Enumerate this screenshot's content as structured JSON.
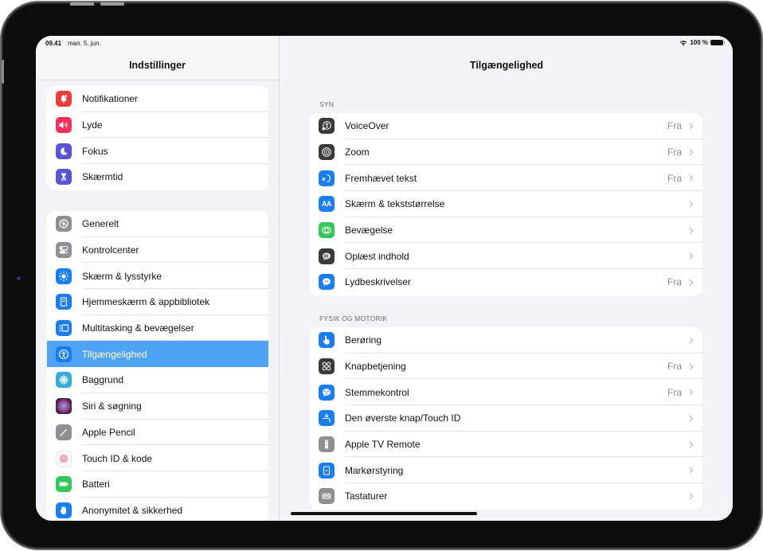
{
  "statusbar": {
    "time": "09.41",
    "date": "man. 5. jun.",
    "battery": "100 %"
  },
  "sidebar": {
    "title": "Indstillinger",
    "group1": [
      {
        "label": "Notifikationer",
        "icon": "bell-icon",
        "color": "#f23a3a"
      },
      {
        "label": "Lyde",
        "icon": "speaker-icon",
        "color": "#f5305a"
      },
      {
        "label": "Fokus",
        "icon": "moon-icon",
        "color": "#5b53d6"
      },
      {
        "label": "Skærmtid",
        "icon": "hourglass-icon",
        "color": "#5b53d6"
      }
    ],
    "group2": [
      {
        "label": "Generelt",
        "icon": "gear-icon",
        "color": "#8e8e93"
      },
      {
        "label": "Kontrolcenter",
        "icon": "toggles-icon",
        "color": "#8e8e93"
      },
      {
        "label": "Skærm & lysstyrke",
        "icon": "sun-icon",
        "color": "#1a7df2"
      },
      {
        "label": "Hjemmeskærm & appbibliotek",
        "icon": "home-screen-icon",
        "color": "#1a7df2"
      },
      {
        "label": "Multitasking & bevægelser",
        "icon": "multitasking-icon",
        "color": "#1a7df2"
      },
      {
        "label": "Tilgængelighed",
        "icon": "accessibility-icon",
        "color": "#1a7df2",
        "selected": true
      },
      {
        "label": "Baggrund",
        "icon": "flower-icon",
        "color": "#36aadc"
      },
      {
        "label": "Siri & søgning",
        "icon": "siri-icon",
        "color": "#2a2a3a"
      },
      {
        "label": "Apple Pencil",
        "icon": "pencil-icon",
        "color": "#8e8e93"
      },
      {
        "label": "Touch ID & kode",
        "icon": "fingerprint-icon",
        "color": "#ffffff"
      },
      {
        "label": "Batteri",
        "icon": "battery-icon",
        "color": "#34c759"
      },
      {
        "label": "Anonymitet & sikkerhed",
        "icon": "hand-icon",
        "color": "#1a7df2"
      }
    ]
  },
  "main": {
    "title": "Tilgængelighed",
    "sections": [
      {
        "header": "SYN",
        "items": [
          {
            "label": "VoiceOver",
            "value": "Fra",
            "icon": "voiceover-icon",
            "color": "#3a3a3c"
          },
          {
            "label": "Zoom",
            "value": "Fra",
            "icon": "zoom-icon",
            "color": "#3a3a3c"
          },
          {
            "label": "Fremhævet tekst",
            "value": "Fra",
            "icon": "hover-text-icon",
            "color": "#1a7df2"
          },
          {
            "label": "Skærm & tekststørrelse",
            "value": "",
            "icon": "text-size-icon",
            "color": "#1a7df2"
          },
          {
            "label": "Bevægelse",
            "value": "",
            "icon": "motion-icon",
            "color": "#34c759"
          },
          {
            "label": "Oplæst indhold",
            "value": "",
            "icon": "spoken-content-icon",
            "color": "#3a3a3c"
          },
          {
            "label": "Lydbeskrivelser",
            "value": "Fra",
            "icon": "audio-descriptions-icon",
            "color": "#1a7df2"
          }
        ]
      },
      {
        "header": "FYSIK OG MOTORIK",
        "items": [
          {
            "label": "Berøring",
            "value": "",
            "icon": "touch-icon",
            "color": "#1a7df2"
          },
          {
            "label": "Knapbetjening",
            "value": "Fra",
            "icon": "switch-control-icon",
            "color": "#3a3a3c"
          },
          {
            "label": "Stemmekontrol",
            "value": "Fra",
            "icon": "voice-control-icon",
            "color": "#1a7df2"
          },
          {
            "label": "Den øverste knap/Touch ID",
            "value": "",
            "icon": "top-button-icon",
            "color": "#1a7df2"
          },
          {
            "label": "Apple TV Remote",
            "value": "",
            "icon": "remote-icon",
            "color": "#8e8e93"
          },
          {
            "label": "Markørstyring",
            "value": "",
            "icon": "pointer-control-icon",
            "color": "#1a7df2"
          },
          {
            "label": "Tastaturer",
            "value": "",
            "icon": "keyboard-icon",
            "color": "#8e8e93"
          }
        ]
      }
    ]
  }
}
